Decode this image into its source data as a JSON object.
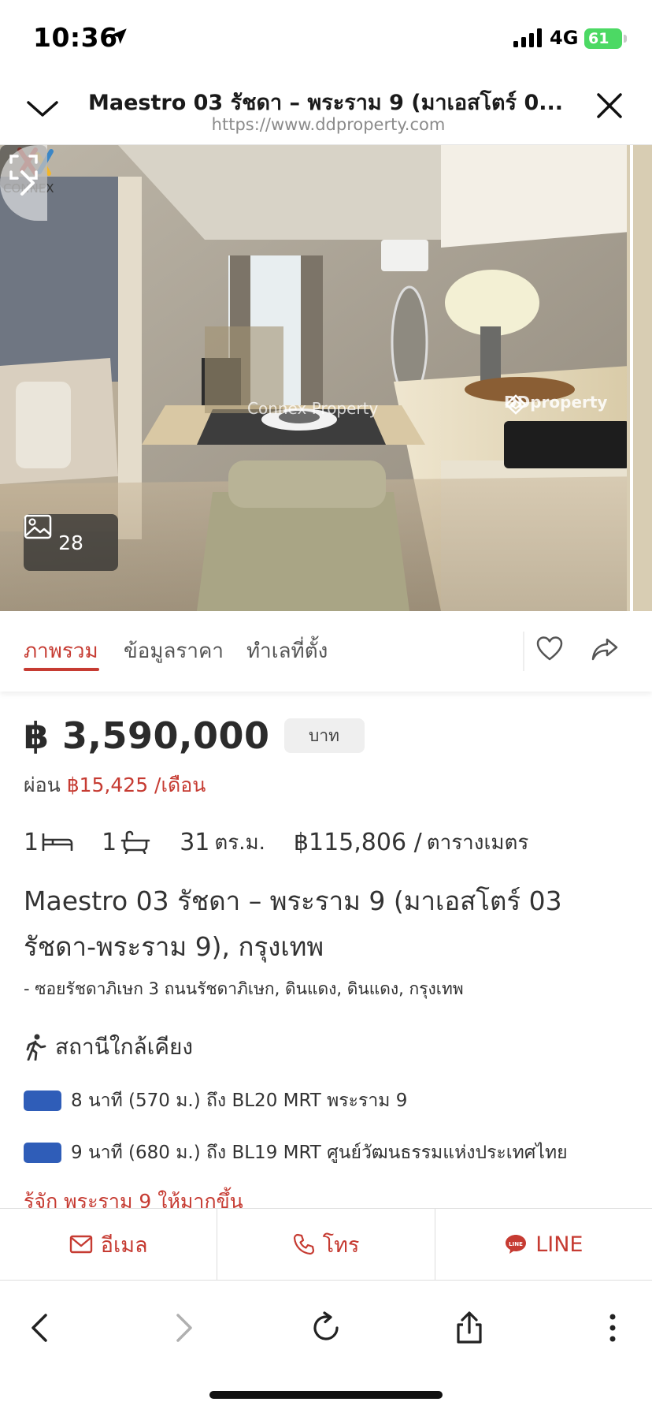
{
  "status_bar": {
    "time": "10:36",
    "network": "4G",
    "battery": "61"
  },
  "browser_header": {
    "title": "Maestro 03 รัชดา – พระราม 9 (มาเอสโตร์ 0...",
    "url": "https://www.ddproperty.com"
  },
  "gallery": {
    "photo_count": "28",
    "watermark_agent": "Connex Property",
    "watermark_site": "DDproperty",
    "brand_logo_text": "CONNEX"
  },
  "tabs": [
    {
      "label": "ภาพรวม",
      "active": true
    },
    {
      "label": "ข้อมูลราคา",
      "active": false
    },
    {
      "label": "ทำเลที่ตั้ง",
      "active": false
    }
  ],
  "listing": {
    "price": "฿ 3,590,000",
    "price_unit": "บาท",
    "installment_prefix": "ผ่อน",
    "installment_value": "฿15,425 /เดือน",
    "bedrooms": "1",
    "bathrooms": "1",
    "area_value": "31",
    "area_unit": "ตร.ม.",
    "price_per_sqm_value": "฿115,806 /",
    "price_per_sqm_unit": "ตารางเมตร",
    "title_line1": "Maestro 03 รัชดา – พระราม 9 (มาเอสโตร์ 03",
    "title_line2": "รัชดา-พระราม 9), กรุงเทพ",
    "address": "- ซอยรัชดาภิเษก 3 ถนนรัชดาภิเษก, ดินแดง, ดินแดง, กรุงเทพ"
  },
  "nearby": {
    "heading": "สถานีใกล้เคียง",
    "stations": [
      {
        "text": "8 นาที (570 ม.) ถึง BL20 MRT พระราม 9",
        "line_color": "#2f5db8"
      },
      {
        "text": "9 นาที (680 ม.) ถึง BL19 MRT ศูนย์วัฒนธรรมแห่งประเทศไทย",
        "line_color": "#2f5db8"
      }
    ],
    "know_more": "รู้จัก พระราม 9 ให้มากขึ้น"
  },
  "contact": {
    "email": "อีเมล",
    "phone": "โทร",
    "line": "LINE"
  },
  "colors": {
    "accent": "#c63b32",
    "mrt_blue": "#2f5db8",
    "battery": "#4cd964"
  },
  "icons": [
    "location-arrow-icon",
    "signal-icon",
    "chevron-down-icon",
    "close-icon",
    "photos-icon",
    "expand-icon",
    "heart-icon",
    "share-icon",
    "bed-icon",
    "bath-icon",
    "walking-icon",
    "mail-icon",
    "phone-icon",
    "line-icon",
    "back-icon",
    "forward-icon",
    "reload-icon",
    "upload-icon",
    "more-icon"
  ]
}
